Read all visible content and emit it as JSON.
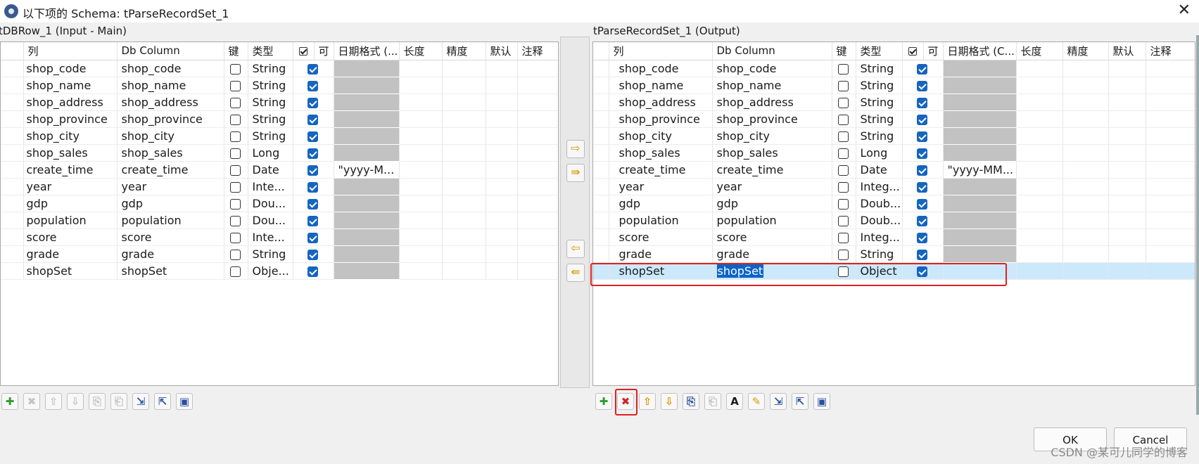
{
  "window": {
    "title": "以下项的 Schema: tParseRecordSet_1",
    "close_glyph": "✕"
  },
  "left_panel": {
    "title": "tDBRow_1 (Input - Main)",
    "columns": [
      "列",
      "Db Column",
      "键",
      "类型",
      "可",
      "日期格式 (...",
      "长度",
      "精度",
      "默认",
      "注释"
    ],
    "rows": [
      {
        "col": "shop_code",
        "db": "shop_code",
        "key": false,
        "type": "String",
        "nullable": true,
        "date": "",
        "gray": true
      },
      {
        "col": "shop_name",
        "db": "shop_name",
        "key": false,
        "type": "String",
        "nullable": true,
        "date": "",
        "gray": true
      },
      {
        "col": "shop_address",
        "db": "shop_address",
        "key": false,
        "type": "String",
        "nullable": true,
        "date": "",
        "gray": true
      },
      {
        "col": "shop_province",
        "db": "shop_province",
        "key": false,
        "type": "String",
        "nullable": true,
        "date": "",
        "gray": true
      },
      {
        "col": "shop_city",
        "db": "shop_city",
        "key": false,
        "type": "String",
        "nullable": true,
        "date": "",
        "gray": true
      },
      {
        "col": "shop_sales",
        "db": "shop_sales",
        "key": false,
        "type": "Long",
        "nullable": true,
        "date": "",
        "gray": true
      },
      {
        "col": "create_time",
        "db": "create_time",
        "key": false,
        "type": "Date",
        "nullable": true,
        "date": "\"yyyy-M...",
        "gray": false
      },
      {
        "col": "year",
        "db": "year",
        "key": false,
        "type": "Inte...",
        "nullable": true,
        "date": "",
        "gray": true
      },
      {
        "col": "gdp",
        "db": "gdp",
        "key": false,
        "type": "Dou...",
        "nullable": true,
        "date": "",
        "gray": true
      },
      {
        "col": "population",
        "db": "population",
        "key": false,
        "type": "Dou...",
        "nullable": true,
        "date": "",
        "gray": true
      },
      {
        "col": "score",
        "db": "score",
        "key": false,
        "type": "Inte...",
        "nullable": true,
        "date": "",
        "gray": true
      },
      {
        "col": "grade",
        "db": "grade",
        "key": false,
        "type": "String",
        "nullable": true,
        "date": "",
        "gray": true
      },
      {
        "col": "shopSet",
        "db": "shopSet",
        "key": false,
        "type": "Obje...",
        "nullable": true,
        "date": "",
        "gray": true
      }
    ]
  },
  "right_panel": {
    "title": "tParseRecordSet_1 (Output)",
    "columns": [
      "列",
      "Db Column",
      "键",
      "类型",
      "可",
      "日期格式 (C...",
      "长度",
      "精度",
      "默认",
      "注释"
    ],
    "rows": [
      {
        "col": "shop_code",
        "db": "shop_code",
        "key": false,
        "type": "String",
        "nullable": true,
        "date": "",
        "gray": true
      },
      {
        "col": "shop_name",
        "db": "shop_name",
        "key": false,
        "type": "String",
        "nullable": true,
        "date": "",
        "gray": true
      },
      {
        "col": "shop_address",
        "db": "shop_address",
        "key": false,
        "type": "String",
        "nullable": true,
        "date": "",
        "gray": true
      },
      {
        "col": "shop_province",
        "db": "shop_province",
        "key": false,
        "type": "String",
        "nullable": true,
        "date": "",
        "gray": true
      },
      {
        "col": "shop_city",
        "db": "shop_city",
        "key": false,
        "type": "String",
        "nullable": true,
        "date": "",
        "gray": true
      },
      {
        "col": "shop_sales",
        "db": "shop_sales",
        "key": false,
        "type": "Long",
        "nullable": true,
        "date": "",
        "gray": true
      },
      {
        "col": "create_time",
        "db": "create_time",
        "key": false,
        "type": "Date",
        "nullable": true,
        "date": "\"yyyy-MM...",
        "gray": false
      },
      {
        "col": "year",
        "db": "year",
        "key": false,
        "type": "Integ...",
        "nullable": true,
        "date": "",
        "gray": true
      },
      {
        "col": "gdp",
        "db": "gdp",
        "key": false,
        "type": "Doub...",
        "nullable": true,
        "date": "",
        "gray": true
      },
      {
        "col": "population",
        "db": "population",
        "key": false,
        "type": "Doub...",
        "nullable": true,
        "date": "",
        "gray": true
      },
      {
        "col": "score",
        "db": "score",
        "key": false,
        "type": "Integ...",
        "nullable": true,
        "date": "",
        "gray": true
      },
      {
        "col": "grade",
        "db": "grade",
        "key": false,
        "type": "String",
        "nullable": true,
        "date": "",
        "gray": true
      },
      {
        "col": "shopSet",
        "db": "shopSet",
        "key": false,
        "type": "Object",
        "nullable": true,
        "date": "",
        "gray": false,
        "selected": true
      }
    ]
  },
  "middle_buttons": [
    {
      "glyph": "⇨",
      "icon": "copy-right-icon"
    },
    {
      "glyph": "⇛",
      "icon": "copy-all-right-icon"
    },
    {
      "glyph": "⇦",
      "icon": "copy-left-icon"
    },
    {
      "glyph": "⇚",
      "icon": "copy-all-left-icon"
    }
  ],
  "left_toolbar": [
    {
      "glyph": "✚",
      "icon": "add-icon",
      "color": "#2f9a2f",
      "enabled": true
    },
    {
      "glyph": "✖",
      "icon": "remove-icon",
      "color": "#c4c4c4",
      "enabled": false
    },
    {
      "glyph": "⇧",
      "icon": "move-up-icon",
      "color": "#c4c4c4",
      "enabled": false
    },
    {
      "glyph": "⇩",
      "icon": "move-down-icon",
      "color": "#c4c4c4",
      "enabled": false
    },
    {
      "glyph": "⎘",
      "icon": "copy-icon",
      "color": "#c4c4c4",
      "enabled": false
    },
    {
      "glyph": "⎗",
      "icon": "paste-icon",
      "color": "#c4c4c4",
      "enabled": false
    },
    {
      "glyph": "⇲",
      "icon": "import-icon",
      "color": "#2a4fa0",
      "enabled": true
    },
    {
      "glyph": "⇱",
      "icon": "export-icon",
      "color": "#2a4fa0",
      "enabled": true
    },
    {
      "glyph": "▣",
      "icon": "save-icon",
      "color": "#2a4fa0",
      "enabled": true
    }
  ],
  "right_toolbar": [
    {
      "glyph": "✚",
      "icon": "add-icon",
      "color": "#2f9a2f",
      "enabled": true
    },
    {
      "glyph": "✖",
      "icon": "remove-icon",
      "color": "#d32424",
      "enabled": true
    },
    {
      "glyph": "⇧",
      "icon": "move-up-icon",
      "color": "#d99a00",
      "enabled": true
    },
    {
      "glyph": "⇩",
      "icon": "move-down-icon",
      "color": "#d99a00",
      "enabled": true
    },
    {
      "glyph": "⎘",
      "icon": "copy-icon",
      "color": "#2a4fa0",
      "enabled": true
    },
    {
      "glyph": "⎗",
      "icon": "paste-icon",
      "color": "#c4c4c4",
      "enabled": false
    },
    {
      "glyph": "A",
      "icon": "font-icon",
      "color": "#1a1a1a",
      "enabled": true
    },
    {
      "glyph": "✎",
      "icon": "edit-icon",
      "color": "#d99a00",
      "enabled": true
    },
    {
      "glyph": "⇲",
      "icon": "import-icon",
      "color": "#2a4fa0",
      "enabled": true
    },
    {
      "glyph": "⇱",
      "icon": "export-icon",
      "color": "#2a4fa0",
      "enabled": true
    },
    {
      "glyph": "▣",
      "icon": "save-icon",
      "color": "#2a4fa0",
      "enabled": true
    }
  ],
  "buttons": {
    "ok": "OK",
    "cancel": "Cancel"
  },
  "watermark": "CSDN @某可儿同学的博客",
  "colors": {
    "highlight_border": "#e02020",
    "selection": "#cce8fb",
    "checkbox": "#1565c0"
  }
}
